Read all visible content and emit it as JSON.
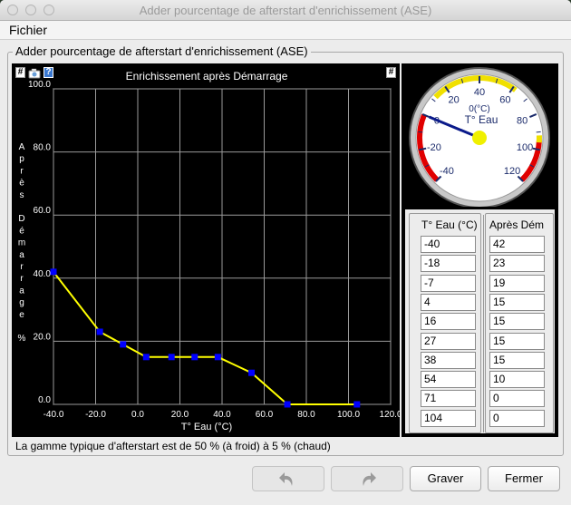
{
  "window": {
    "title": "Adder pourcentage de afterstart d'enrichissement (ASE)"
  },
  "menu": {
    "file": "Fichier"
  },
  "group": {
    "title": "Adder pourcentage de afterstart d'enrichissement (ASE)"
  },
  "chart": {
    "hash_label": "#",
    "right_hash_label": "#",
    "help_label": "?"
  },
  "chart_data": {
    "type": "line",
    "title": "Enrichissement après Démarrage",
    "xlabel": "T° Eau (°C)",
    "ylabel": "Après Démarrage %",
    "ylabel_letters": [
      "A",
      "p",
      "r",
      "è",
      "s",
      "",
      "D",
      "é",
      "m",
      "a",
      "r",
      "r",
      "a",
      "g",
      "e",
      "",
      "%"
    ],
    "xlim": [
      -40,
      120
    ],
    "ylim": [
      0,
      100
    ],
    "x_ticks": [
      "-40.0",
      "-20.0",
      "0.0",
      "20.0",
      "40.0",
      "60.0",
      "80.0",
      "100.0",
      "120.0"
    ],
    "y_ticks": [
      "0.0",
      "20.0",
      "40.0",
      "60.0",
      "80.0",
      "100.0"
    ],
    "grid": true,
    "line_color": "#ffff00",
    "point_color": "#0000ff",
    "series": [
      {
        "x": [
          -40,
          -18,
          -7,
          4,
          16,
          27,
          38,
          54,
          71,
          104
        ],
        "y": [
          42,
          23,
          19,
          15,
          15,
          15,
          15,
          10,
          0,
          0
        ]
      }
    ]
  },
  "gauge": {
    "label_top": "0(°C)",
    "label": "T° Eau",
    "ticks": [
      "-40",
      "-20",
      "0",
      "20",
      "40",
      "60",
      "80",
      "100",
      "120"
    ],
    "value": 0
  },
  "table": {
    "col1_header": "T° Eau (°C)",
    "col2_header": "Après Dém",
    "rows": [
      {
        "temp": "-40",
        "value": "42"
      },
      {
        "temp": "-18",
        "value": "23"
      },
      {
        "temp": "-7",
        "value": "19"
      },
      {
        "temp": "4",
        "value": "15"
      },
      {
        "temp": "16",
        "value": "15"
      },
      {
        "temp": "27",
        "value": "15"
      },
      {
        "temp": "38",
        "value": "15"
      },
      {
        "temp": "54",
        "value": "10"
      },
      {
        "temp": "71",
        "value": "0"
      },
      {
        "temp": "104",
        "value": "0"
      }
    ]
  },
  "status": "La gamme typique d'afterstart est de 50 % (à froid) à 5 % (chaud)",
  "buttons": {
    "write": "Graver",
    "close": "Fermer"
  }
}
